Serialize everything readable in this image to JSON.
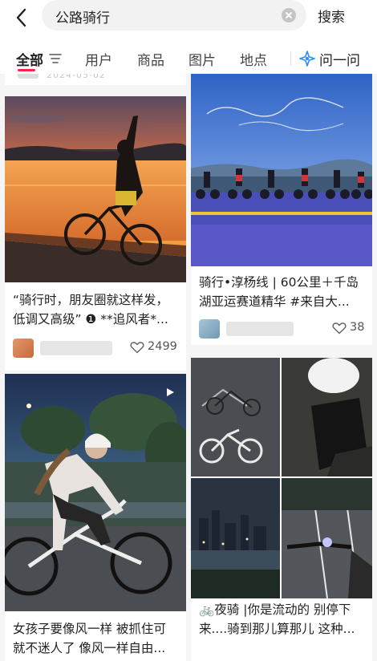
{
  "search": {
    "query": "公路骑行",
    "submit_label": "搜索"
  },
  "tabs": {
    "items": [
      "全部",
      "用户",
      "商品",
      "图片",
      "地点"
    ],
    "ask_label": "问一问",
    "accent": "#ff2442"
  },
  "feed": {
    "partial_date": "2024-05-02",
    "cards": [
      {
        "title_line1": "“骑行时，朋友圈就这样发，",
        "title_line2": "低调又高级” ❶ **追风者*...",
        "likes": "2499"
      },
      {
        "title_line1": "骑行•淳杨线 | 60公里＋千岛",
        "title_line2": "湖亚运赛道精华 #来自大...",
        "likes": "38"
      },
      {
        "title_line1": "女孩子要像风一样 被抓住可",
        "title_line2": "就不迷人了 像风一样自由..."
      },
      {
        "title_line1": "🚲夜骑 |你是流动的 别停下",
        "title_line2": "来....骑到那儿算那儿 这种..."
      }
    ]
  },
  "icons": [
    "back-arrow-icon",
    "clear-icon",
    "filter-icon",
    "sparkle-icon",
    "heart-icon",
    "video-play-icon"
  ]
}
